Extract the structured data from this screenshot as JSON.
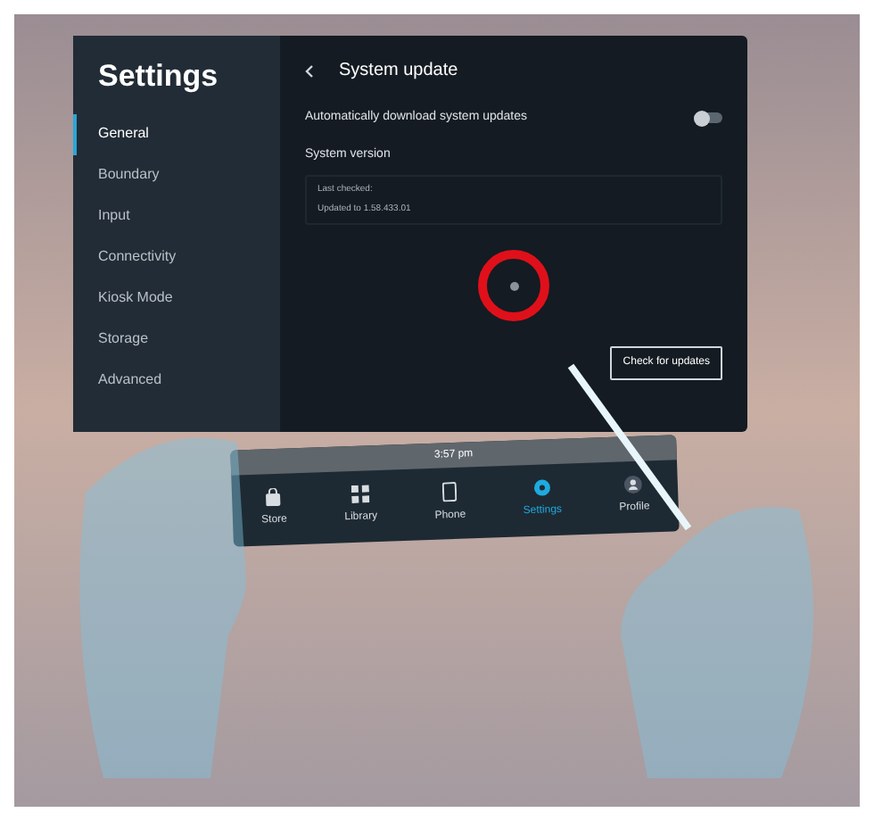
{
  "settings": {
    "title": "Settings",
    "sidebar": [
      {
        "label": "General",
        "selected": true
      },
      {
        "label": "Boundary",
        "selected": false
      },
      {
        "label": "Input",
        "selected": false
      },
      {
        "label": "Connectivity",
        "selected": false
      },
      {
        "label": "Kiosk Mode",
        "selected": false
      },
      {
        "label": "Storage",
        "selected": false
      },
      {
        "label": "Advanced",
        "selected": false
      }
    ],
    "page_title": "System update",
    "auto_update": {
      "label": "Automatically download system updates",
      "on": false
    },
    "version_heading": "System version",
    "version_lines": [
      "Last checked:",
      "Updated to 1.58.433.01"
    ],
    "check_button": "Check for updates"
  },
  "taskbar": {
    "time": "3:57 pm",
    "items": [
      {
        "label": "Store",
        "selected": false
      },
      {
        "label": "Library",
        "selected": false
      },
      {
        "label": "Phone",
        "selected": false
      },
      {
        "label": "Settings",
        "selected": true
      },
      {
        "label": "Profile",
        "selected": false
      }
    ]
  }
}
